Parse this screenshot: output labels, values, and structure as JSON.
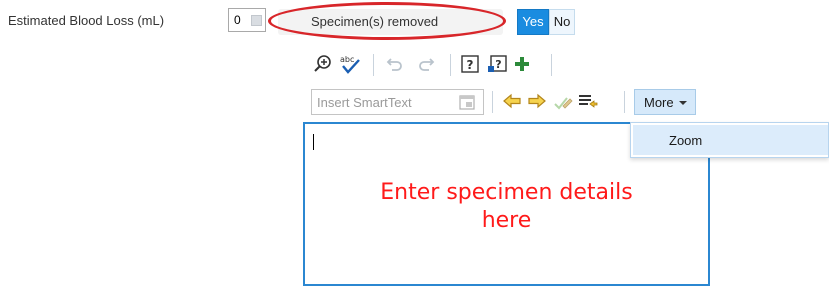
{
  "fields": {
    "ebl_label": "Estimated Blood Loss (mL)",
    "ebl_value": "0",
    "specimen_label": "Specimen(s) removed",
    "yes_label": "Yes",
    "no_label": "No",
    "selected_option": "Yes"
  },
  "toolbar": {
    "row1_icons": [
      "zoom-in-icon",
      "spellcheck-icon",
      "undo-icon",
      "redo-icon",
      "help-icon",
      "smart-help-icon",
      "add-icon"
    ],
    "insert_smarttext_placeholder": "Insert SmartText",
    "row2_icons": [
      "smartlist-icon",
      "prev-arrow-icon",
      "next-arrow-icon",
      "edit-check-icon",
      "list-forward-icon"
    ],
    "more_label": "More"
  },
  "more_menu": {
    "items": [
      "Zoom"
    ]
  },
  "editor": {
    "annotation": "Enter specimen details\nhere"
  },
  "colors": {
    "accent_blue": "#1a8ce0",
    "annotation_red": "#ff1a1a",
    "ellipse_red": "#d8262a"
  }
}
